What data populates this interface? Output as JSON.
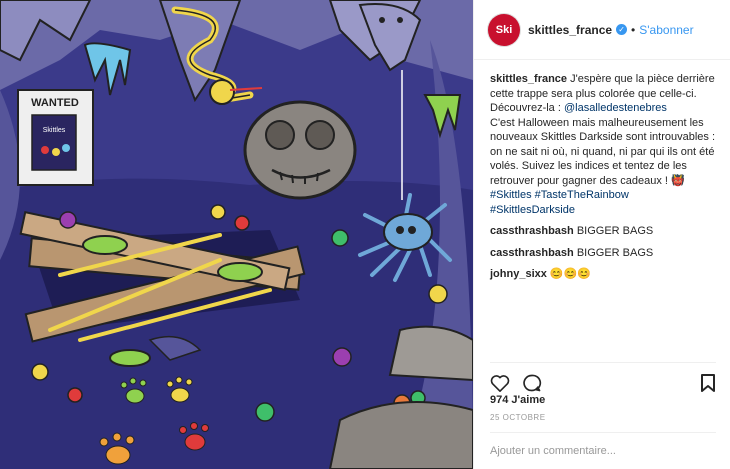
{
  "post": {
    "username": "skittles_france",
    "avatar_text": "Ski",
    "separator": "•",
    "follow_label": "S'abonner",
    "verified_icon": "verified-badge-icon",
    "media_text": {
      "wanted": "WANTED",
      "pack_brand": "Skittles"
    },
    "caption": {
      "username": "skittles_france",
      "line1": "J'espère que la pièce derrière cette trappe sera plus colorée que celle-ci.",
      "line2_prefix": "Découvrez-la :",
      "mention": "@lasalledestenebres",
      "line3": "C'est Halloween mais malheureusement les nouveaux Skittles Darkside sont introuvables : on ne sait ni où, ni quand, ni par qui ils ont été volés. Suivez les indices et tentez de les retrouver pour gagner des cadeaux ! 👹",
      "hashtags": "#Skittles #TasteTheRainbow #SkittlesDarkside"
    },
    "comments": [
      {
        "user": "cassthrashbash",
        "text": "BIGGER BAGS"
      },
      {
        "user": "cassthrashbash",
        "text": "BIGGER BAGS"
      },
      {
        "user": "johny_sixx",
        "text": "😊😊😊"
      }
    ],
    "likes": "974 J'aime",
    "date": "25 OCTOBRE",
    "comment_placeholder": "Ajouter un commentaire..."
  },
  "colors": {
    "accent": "#3897f0",
    "brand": "#c8102e",
    "background_dark": "#3b3a8a"
  }
}
